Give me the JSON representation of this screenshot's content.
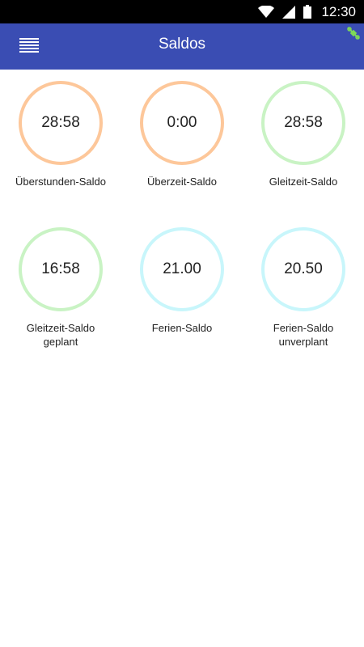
{
  "status_bar": {
    "time": "12:30",
    "icons": [
      "wifi-icon",
      "signal-icon",
      "battery-icon"
    ]
  },
  "app_bar": {
    "title": "Saldos",
    "menu_icon": "hamburger-menu-icon",
    "status_icon": "sync-connected-icon",
    "color": "#3a4db3"
  },
  "saldos": [
    {
      "value": "28:58",
      "label": "Überstunden-Saldo",
      "color": "#fdc79a"
    },
    {
      "value": "0:00",
      "label": "Überzeit-Saldo",
      "color": "#fdc79a"
    },
    {
      "value": "28:58",
      "label": "Gleitzeit-Saldo",
      "color": "#c9f3c4"
    },
    {
      "value": "16:58",
      "label": "Gleitzeit-Saldo\ngeplant",
      "color": "#c9f3c4"
    },
    {
      "value": "21.00",
      "label": "Ferien-Saldo",
      "color": "#c8f6fb"
    },
    {
      "value": "20.50",
      "label": "Ferien-Saldo\nunverplant",
      "color": "#c8f6fb"
    }
  ]
}
